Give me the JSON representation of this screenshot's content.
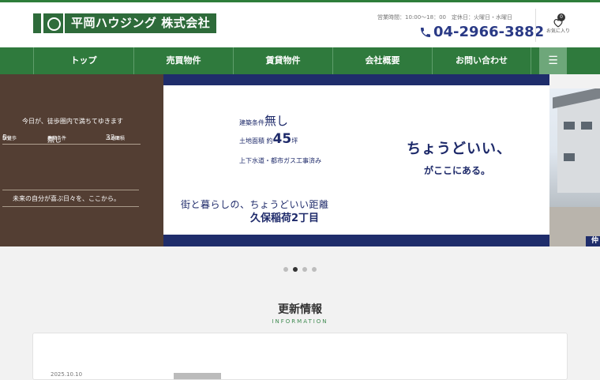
{
  "brand": {
    "logo_text": "平岡ハウジング 株式会社"
  },
  "header": {
    "hours": "営業時間：10:00～18：00　定休日：火曜日・水曜日",
    "phone": "04-2966-3882",
    "favorites": {
      "count": "0",
      "label": "お気に入り"
    }
  },
  "nav": {
    "items": [
      {
        "label": "トップ"
      },
      {
        "label": "売買物件"
      },
      {
        "label": "賃貸物件"
      },
      {
        "label": "会社概要"
      },
      {
        "label": "お問い合わせ"
      }
    ],
    "menu_icon": "hamburger-icon"
  },
  "hero": {
    "left": {
      "line1": "今日が、徒歩圏内で満ちてゆきます",
      "stats": [
        {
          "label": "駅徒歩",
          "value": "5",
          "unit": "分"
        },
        {
          "label": "建築条件",
          "value": "無し",
          "unit": ""
        },
        {
          "label": "土地面積",
          "value": "33",
          "unit": "坪"
        }
      ],
      "line2": "未来の自分が喜ぶ日々を、ここから。"
    },
    "main": {
      "spec1_label": "建築条件",
      "spec1_value": "無し",
      "spec2_label": "土地面積 約",
      "spec2_value": "45",
      "spec2_unit": "坪",
      "spec3": "上下水道・都市ガス工事済み",
      "slogan1": "ちょうどいい、",
      "slogan2": "がここにある。",
      "tagline1": "街と暮らしの、ちょうどいい距離",
      "tagline2": "久保稲荷2丁目"
    },
    "photo_badge": "仲"
  },
  "slider": {
    "dots": 4,
    "active_index": 1
  },
  "news": {
    "title": "更新情報",
    "subtitle": "INFORMATION",
    "first_date": "2025.10.10"
  },
  "colors": {
    "brand_green": "#2f7a3d",
    "navy": "#1f2d6b",
    "phone_blue": "#2a3a86",
    "hero_brown": "#533e33"
  }
}
